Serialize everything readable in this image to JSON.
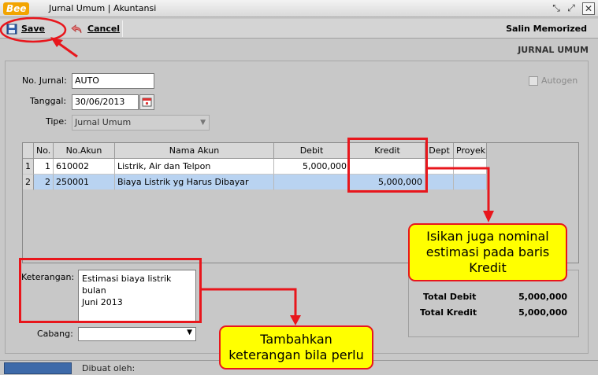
{
  "window": {
    "logo_text": "Bee",
    "title": "Jurnal Umum | Akuntansi",
    "controls": [
      "restore-icon",
      "maximize-icon",
      "close-icon"
    ]
  },
  "toolbar": {
    "save_label": "Save",
    "cancel_label": "Cancel",
    "salin_label": "Salin Memorized"
  },
  "section_title": "JURNAL UMUM",
  "form": {
    "no_jurnal_label": "No. Jurnal:",
    "no_jurnal_value": "AUTO",
    "tanggal_label": "Tanggal:",
    "tanggal_value": "30/06/2013",
    "tipe_label": "Tipe:",
    "tipe_value": "Jurnal Umum",
    "autogen_label": "Autogen",
    "keterangan_label": "Keterangan:",
    "keterangan_value": "Estimasi biaya listrik bulan\nJuni 2013",
    "cabang_label": "Cabang:",
    "cabang_value": ""
  },
  "grid": {
    "columns": [
      "No.",
      "No.Akun",
      "Nama Akun",
      "Debit",
      "Kredit",
      "Dept",
      "Proyek"
    ],
    "rows": [
      {
        "row_num": "1",
        "no": "1",
        "akun": "610002",
        "nama": "Listrik, Air dan Telpon",
        "debit": "5,000,000",
        "kredit": "",
        "dept": "",
        "proyek": ""
      },
      {
        "row_num": "2",
        "no": "2",
        "akun": "250001",
        "nama": "Biaya Listrik yg Harus Dibayar",
        "debit": "",
        "kredit": "5,000,000",
        "dept": "",
        "proyek": ""
      }
    ]
  },
  "totals": {
    "debit_label": "Total Debit",
    "debit_value": "5,000,000",
    "kredit_label": "Total Kredit",
    "kredit_value": "5,000,000"
  },
  "status": {
    "dibuat_label": "Dibuat oleh:"
  },
  "annotations": {
    "callout_kredit": "Isikan juga nominal estimasi pada baris Kredit",
    "callout_keterangan": "Tambahkan keterangan bila perlu",
    "accent_color": "#e8161c",
    "callout_color": "#ffff00"
  }
}
